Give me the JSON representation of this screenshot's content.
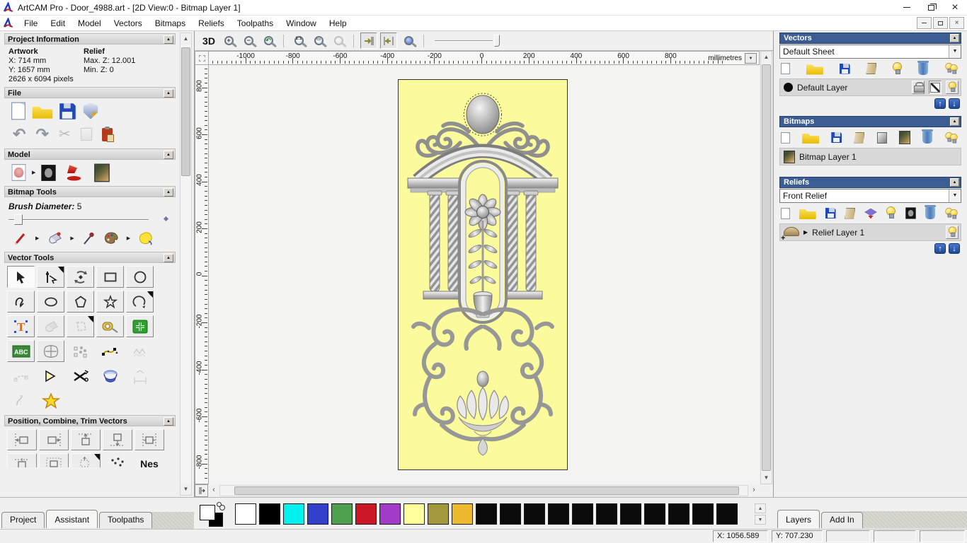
{
  "window": {
    "title": "ArtCAM Pro - Door_4988.art - [2D View:0 - Bitmap Layer 1]"
  },
  "icons": {
    "close": "×",
    "dropdown": "▼",
    "collapse": "▲",
    "flyout": "▶",
    "up": "↑",
    "down": "↓",
    "scroll_left": "‹",
    "scroll_right": "›",
    "scroll_up": "▲",
    "scroll_down": "▼",
    "undo": "↶",
    "redo": "↷",
    "scissors": "✂",
    "zoom_in": "+",
    "zoom_out": "−",
    "plus": "+",
    "text_tool": "T",
    "abc": "ABC"
  },
  "menu": {
    "items": [
      "File",
      "Edit",
      "Model",
      "Vectors",
      "Bitmaps",
      "Reliefs",
      "Toolpaths",
      "Window",
      "Help"
    ]
  },
  "left": {
    "project_information": {
      "title": "Project Information",
      "artwork_heading": "Artwork",
      "relief_heading": "Relief",
      "artwork_x": "X: 714 mm",
      "artwork_y": "Y: 1657 mm",
      "artwork_pixels": "2626 x 6094 pixels",
      "relief_max_z": "Max. Z: 12.001",
      "relief_min_z": "Min. Z: 0"
    },
    "file_section": {
      "title": "File"
    },
    "model_section": {
      "title": "Model"
    },
    "bitmap_tools": {
      "title": "Bitmap Tools",
      "brush_diameter_label": "Brush Diameter:",
      "brush_diameter_value": "5"
    },
    "vector_tools": {
      "title": "Vector Tools"
    },
    "position_tools": {
      "title": "Position, Combine, Trim Vectors",
      "nest_label": "Nes"
    },
    "tabs": [
      {
        "label": "Project"
      },
      {
        "label": "Assistant"
      },
      {
        "label": "Toolpaths"
      }
    ]
  },
  "canvas": {
    "toolbar": {
      "view_3d": "3D"
    },
    "ruler_h": {
      "labels": [
        "-1000",
        "-800",
        "-600",
        "-400",
        "-200",
        "0",
        "200",
        "400",
        "600",
        "800"
      ],
      "unit": "millimetres"
    },
    "ruler_v": {
      "labels": [
        "800",
        "600",
        "400",
        "200",
        "0",
        "-200",
        "-400",
        "-600",
        "-800"
      ]
    },
    "door_color": "#fbfb9d"
  },
  "right": {
    "vectors": {
      "title": "Vectors",
      "sheet_selector": "Default Sheet",
      "layer_name": "Default Layer"
    },
    "bitmaps": {
      "title": "Bitmaps",
      "layer_name": "Bitmap Layer 1"
    },
    "reliefs": {
      "title": "Reliefs",
      "relief_selector": "Front Relief",
      "layer_name": "Relief Layer 1"
    },
    "tabs": [
      {
        "label": "Layers"
      },
      {
        "label": "Add In"
      }
    ]
  },
  "palette": {
    "primary": "#ffffff",
    "secondary": "#000000",
    "colors": [
      "#ffffff",
      "#000000",
      "#00f0f0",
      "#3340cc",
      "#4ea04e",
      "#cc1626",
      "#a23cc8",
      "#ffff9c",
      "#a2973a",
      "#edb92e",
      "#0a0a0a",
      "#0a0a0a",
      "#0a0a0a",
      "#0a0a0a",
      "#0a0a0a",
      "#0a0a0a",
      "#0a0a0a",
      "#0a0a0a",
      "#0a0a0a",
      "#0a0a0a",
      "#0a0a0a"
    ]
  },
  "status": {
    "x": "X: 1056.589",
    "y": "Y: 707.230"
  }
}
